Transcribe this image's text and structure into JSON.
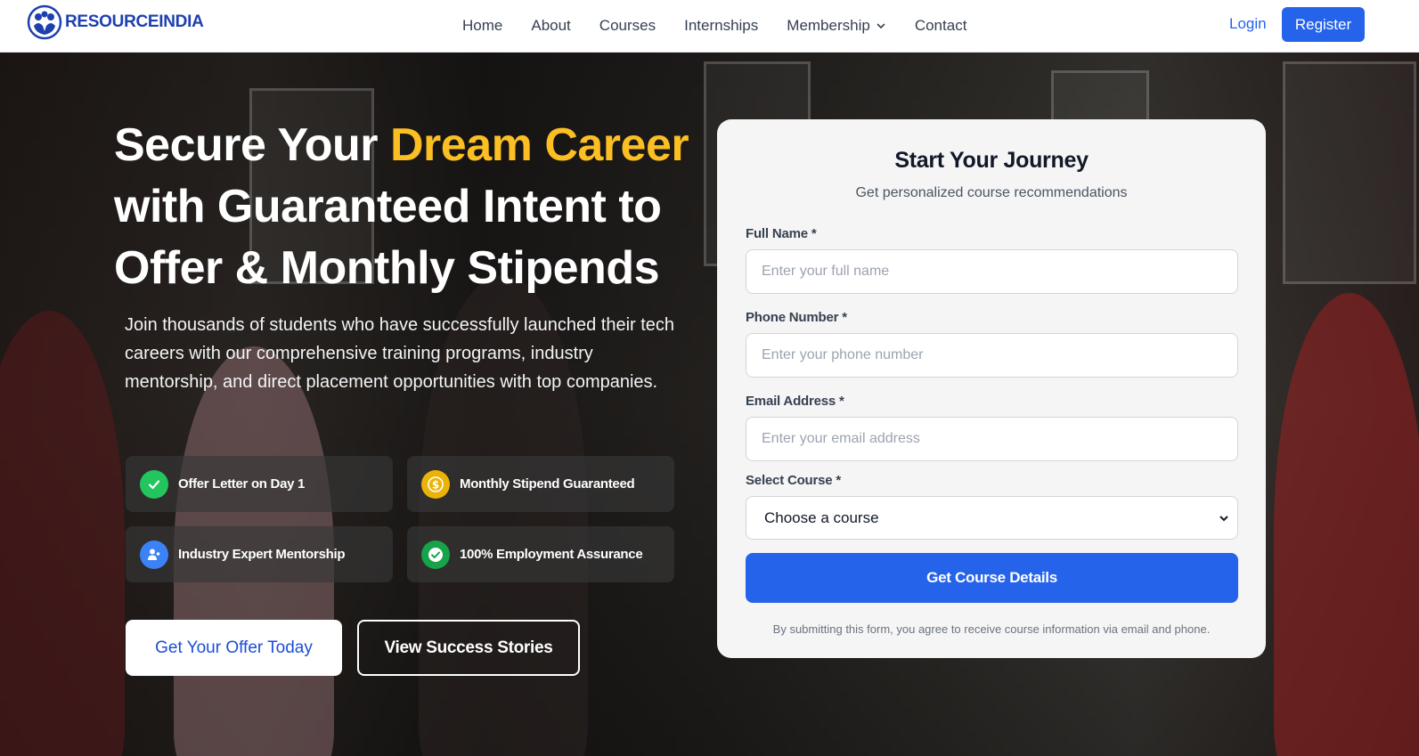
{
  "brand": {
    "name": "RESOURCEINDIA",
    "color": "#1e40af"
  },
  "nav": {
    "items": [
      {
        "label": "Home"
      },
      {
        "label": "About"
      },
      {
        "label": "Courses"
      },
      {
        "label": "Internships"
      },
      {
        "label": "Membership",
        "icon": "chevron-down-icon"
      },
      {
        "label": "Contact"
      }
    ],
    "login": "Login",
    "register": "Register"
  },
  "hero": {
    "headline_part1": "Secure Your ",
    "headline_accent": "Dream Career",
    "headline_part2": " with Guaranteed Intent to Offer & Monthly Stipends",
    "accent_color": "#fbbf24",
    "subtext": "Join thousands of students who have successfully launched their tech careers with our comprehensive training programs, industry mentorship, and direct placement opportunities with top companies.",
    "features": [
      {
        "label": "Offer Letter on Day 1",
        "icon": "check-icon",
        "color": "#22c55e"
      },
      {
        "label": "Monthly Stipend Guaranteed",
        "icon": "dollar-icon",
        "color": "#eab308"
      },
      {
        "label": "Industry Expert Mentorship",
        "icon": "user-icon",
        "color": "#3b82f6"
      },
      {
        "label": "100% Employment Assurance",
        "icon": "check-circle-icon",
        "color": "#16a34a"
      }
    ],
    "cta_primary": "Get Your Offer Today",
    "cta_secondary": "View Success Stories"
  },
  "form": {
    "title": "Start Your Journey",
    "subtitle": "Get personalized course recommendations",
    "fields": [
      {
        "label": "Full Name *",
        "placeholder": "Enter your full name"
      },
      {
        "label": "Phone Number *",
        "placeholder": "Enter your phone number"
      },
      {
        "label": "Email Address *",
        "placeholder": "Enter your email address"
      }
    ],
    "course_label": "Select Course *",
    "course_selected": "Choose a course",
    "submit": "Get Course Details",
    "disclaimer": "By submitting this form, you agree to receive course information via email and phone.",
    "accent_color": "#2563eb"
  }
}
